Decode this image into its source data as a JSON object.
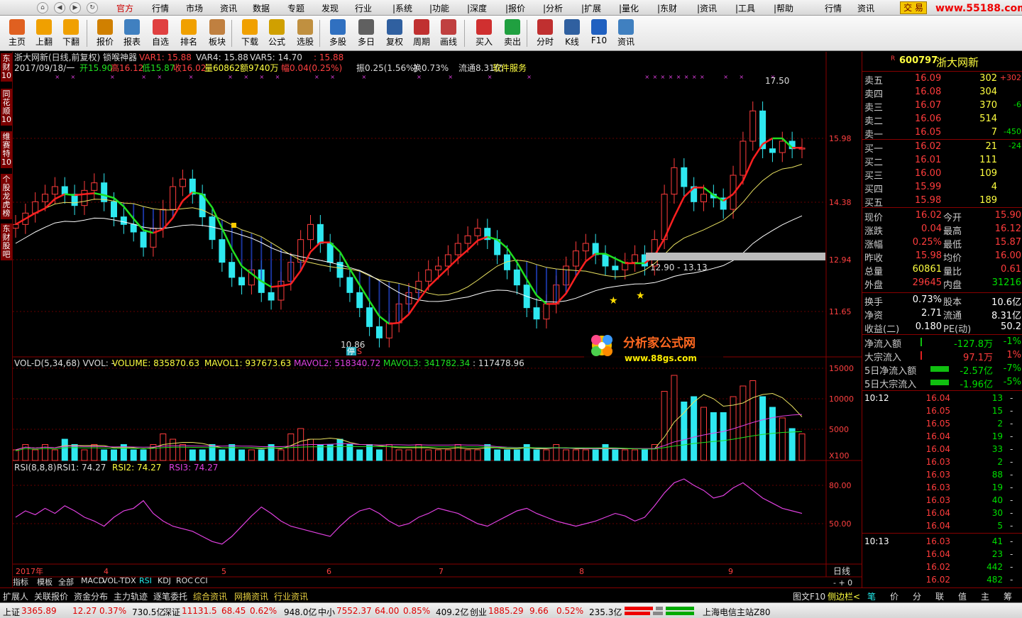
{
  "menu": {
    "items": [
      "官方",
      "行情",
      "市场",
      "资讯",
      "数据",
      "专题",
      "发现",
      "行业",
      "|系统",
      "|功能",
      "|深度",
      "|报价",
      "|分析",
      "|扩展",
      "|量化",
      "|东财",
      "|资讯",
      "|工具",
      "|帮助"
    ],
    "right": [
      "行情",
      "资讯"
    ],
    "trade": "交 易",
    "site": "www.55188.com"
  },
  "toolbar": [
    "主页",
    "上翻",
    "下翻",
    "报价",
    "报表",
    "自选",
    "排名",
    "板块",
    "下载",
    "公式",
    "选股",
    "多股",
    "多日",
    "复权",
    "周期",
    "画线",
    "买入",
    "卖出",
    "分时",
    "K线",
    "F10",
    "资讯"
  ],
  "left_tabs": [
    "东财10",
    "同花顺10",
    "维赛特10",
    "个股龙虎榜",
    "东财股吧"
  ],
  "chart": {
    "title": "浙大网新(日线,前复权) 锁喉神器",
    "var1": "VAR1: 15.88",
    "var4": "VAR4: 15.88",
    "var5": "VAR5: 14.70",
    "var6": ": 15.88",
    "date": "2017/09/18/一",
    "open": "开15.90",
    "high": "高16.12",
    "low": "低15.87",
    "close": "收16.02",
    "vol": "量60862",
    "amount": "额9740万",
    "amp": "幅0.04(0.25%)",
    "zhen": "振0.25(1.56%)",
    "turnover": "换0.73%",
    "float": "流通8.31亿",
    "sector": "软件服务",
    "y_labels": [
      "15.98",
      "14.38",
      "12.94",
      "11.65"
    ],
    "hi_label": "17.50",
    "lo_label": "10.86",
    "range_label": "12.90 - 13.13",
    "ting": "停",
    "s_mark": "S",
    "vol_title": "VOL-D(5,34,68)  VVOL: -",
    "volume": "VOLUME: 835870.63",
    "mavol1": "MAVOL1: 937673.63",
    "mavol2": "MAVOL2: 518340.72",
    "mavol3": "MAVOL3: 341782.34",
    "vol_extra": ": 117478.96",
    "vol_y": [
      "15000",
      "10000",
      "5000"
    ],
    "vol_unit": "X100",
    "rsi_title": "RSI(8,8,8)",
    "rsi1": "RSI1: 74.27",
    "rsi2": "RSI2: 74.27",
    "rsi3": "RSI3: 74.27",
    "rsi_y": [
      "80.00",
      "50.00"
    ],
    "x_labels": [
      "2017年",
      "4",
      "5",
      "6",
      "7",
      "8",
      "9"
    ],
    "x_unit": "日线",
    "logo_cn": "分析家公式网",
    "logo_url": "www.88gs.com"
  },
  "chart_data": {
    "type": "candlestick",
    "ylim": [
      10.5,
      18.0
    ],
    "close_series": [
      14.0,
      14.3,
      14.6,
      14.8,
      15.0,
      14.8,
      14.5,
      14.9,
      15.1,
      14.6,
      14.2,
      14.0,
      13.8,
      13.4,
      13.9,
      14.4,
      15.0,
      15.2,
      14.8,
      14.2,
      13.6,
      13.0,
      12.6,
      12.4,
      12.8,
      12.2,
      12.0,
      12.5,
      13.0,
      13.6,
      14.0,
      13.5,
      13.0,
      12.6,
      12.2,
      11.8,
      11.3,
      11.0,
      11.4,
      11.9,
      12.2,
      12.5,
      12.8,
      12.9,
      13.2,
      13.5,
      13.7,
      13.9,
      13.6,
      13.2,
      12.8,
      12.4,
      11.8,
      11.5,
      11.9,
      12.4,
      12.9,
      13.3,
      13.5,
      13.2,
      12.9,
      12.8,
      13.0,
      13.2,
      12.9,
      13.6,
      14.8,
      15.5,
      15.0,
      14.6,
      14.8,
      14.7,
      14.4,
      15.3,
      16.2,
      17.0,
      16.0,
      15.9,
      16.2,
      16.0,
      16.02
    ],
    "vol_series": [
      2,
      3,
      2,
      3,
      2,
      4,
      3,
      2,
      3,
      2,
      2,
      3,
      2,
      2,
      3,
      5,
      4,
      3,
      2,
      2,
      3,
      2,
      3,
      2,
      2,
      2,
      3,
      2,
      5,
      6,
      4,
      3,
      3,
      4,
      3,
      2,
      3,
      2,
      3,
      2,
      2,
      3,
      2,
      2,
      2,
      3,
      2,
      2,
      3,
      2,
      2,
      2,
      3,
      2,
      2,
      3,
      2,
      2,
      2,
      2,
      3,
      2,
      2,
      2,
      2,
      3,
      13,
      16,
      11,
      12,
      10,
      9,
      9,
      12,
      14,
      15,
      12,
      10,
      8,
      6,
      5
    ],
    "rsi_series": [
      55,
      60,
      57,
      62,
      58,
      64,
      60,
      55,
      52,
      48,
      55,
      60,
      62,
      68,
      58,
      52,
      48,
      46,
      44,
      40,
      36,
      34,
      40,
      48,
      56,
      63,
      58,
      52,
      48,
      46,
      44,
      42,
      40,
      48,
      55,
      60,
      62,
      58,
      52,
      48,
      50,
      55,
      58,
      62,
      60,
      58,
      54,
      50,
      48,
      52,
      56,
      60,
      62,
      58,
      55,
      52,
      50,
      48,
      50,
      52,
      55,
      58,
      56,
      52,
      55,
      64,
      74,
      82,
      85,
      80,
      76,
      70,
      72,
      78,
      82,
      76,
      70,
      66,
      62,
      60,
      58
    ]
  },
  "quote": {
    "code": "600797",
    "name": "浙大网新",
    "asks": [
      [
        "卖五",
        "16.09",
        "302",
        "+302"
      ],
      [
        "卖四",
        "16.08",
        "304",
        ""
      ],
      [
        "卖三",
        "16.07",
        "370",
        "-6"
      ],
      [
        "卖二",
        "16.06",
        "514",
        ""
      ],
      [
        "卖一",
        "16.05",
        "7",
        "-450"
      ]
    ],
    "bids": [
      [
        "买一",
        "16.02",
        "21",
        "-24"
      ],
      [
        "买二",
        "16.01",
        "111",
        ""
      ],
      [
        "买三",
        "16.00",
        "109",
        ""
      ],
      [
        "买四",
        "15.99",
        "4",
        ""
      ],
      [
        "买五",
        "15.98",
        "189",
        ""
      ]
    ],
    "stats": [
      [
        "现价",
        "16.02",
        "今开",
        "15.90"
      ],
      [
        "涨跌",
        "0.04",
        "最高",
        "16.12"
      ],
      [
        "涨幅",
        "0.25%",
        "最低",
        "15.87"
      ],
      [
        "昨收",
        "15.98",
        "均价",
        "16.00"
      ],
      [
        "总量",
        "60861",
        "量比",
        "0.61"
      ],
      [
        "外盘",
        "29645",
        "内盘",
        "31216"
      ]
    ],
    "stats2": [
      [
        "换手",
        "0.73%",
        "股本",
        "10.6亿"
      ],
      [
        "净资",
        "2.71",
        "流通",
        "8.31亿"
      ],
      [
        "收益(二)",
        "0.180",
        "PE(动)",
        "50.2"
      ]
    ],
    "flows": [
      [
        "净流入额",
        "-127.8万",
        "-1%"
      ],
      [
        "大宗流入",
        "97.1万",
        "1%"
      ],
      [
        "5日净流入额",
        "-2.57亿",
        "-7%"
      ],
      [
        "5日大宗流入",
        "-1.96亿",
        "-5%"
      ]
    ],
    "ticks": [
      [
        "10:12",
        "16.04",
        "13"
      ],
      [
        "",
        "16.05",
        "15"
      ],
      [
        "",
        "16.05",
        "2"
      ],
      [
        "",
        "16.04",
        "19"
      ],
      [
        "",
        "16.04",
        "33"
      ],
      [
        "",
        "16.03",
        "2"
      ],
      [
        "",
        "16.03",
        "88"
      ],
      [
        "",
        "16.03",
        "19"
      ],
      [
        "",
        "16.03",
        "40"
      ],
      [
        "",
        "16.04",
        "30"
      ],
      [
        "",
        "16.04",
        "5"
      ],
      [
        "10:13",
        "16.03",
        "41"
      ],
      [
        "",
        "16.04",
        "23"
      ],
      [
        "",
        "16.02",
        "442"
      ],
      [
        "",
        "16.02",
        "482"
      ]
    ],
    "bottom_tabs": [
      "笔",
      "价",
      "分",
      "联",
      "值",
      "主",
      "筹"
    ]
  },
  "tabbar": {
    "row1": [
      "指标",
      "模板",
      "全部",
      "MACD",
      "VOL-TDX",
      "RSI",
      "KDJ",
      "ROC",
      "CCI"
    ],
    "row2": [
      "扩展人",
      "关联报价",
      "资金分布",
      "主力轨迹",
      "逐笔委托",
      "综合资讯",
      "网摘资讯",
      "行业资讯"
    ],
    "right": [
      "图文F10",
      "侧边栏<"
    ]
  },
  "status": {
    "sh": "上证",
    "sh_val": "3365.89",
    "sh_chg": "12.27",
    "sh_pct": "0.37%",
    "sh_amt": "730.5亿",
    "sz": "深证",
    "sz_val": "11131.5",
    "sz_chg": "68.45",
    "sz_pct": "0.62%",
    "sz_amt": "948.0亿",
    "zx": "中小",
    "zx_val": "7552.37",
    "zx_chg": "64.00",
    "zx_pct": "0.85%",
    "zx_amt": "409.2亿",
    "cy": "创业",
    "cy_val": "1885.29",
    "cy_chg": "9.66",
    "cy_pct": "0.52%",
    "cy_amt": "235.3亿",
    "server": "上海电信主站Z80"
  },
  "colors": {
    "up": "#ff3c3c",
    "down": "#2ee8f0",
    "ma_red": "#ff2020",
    "ma_green": "#20e020"
  }
}
